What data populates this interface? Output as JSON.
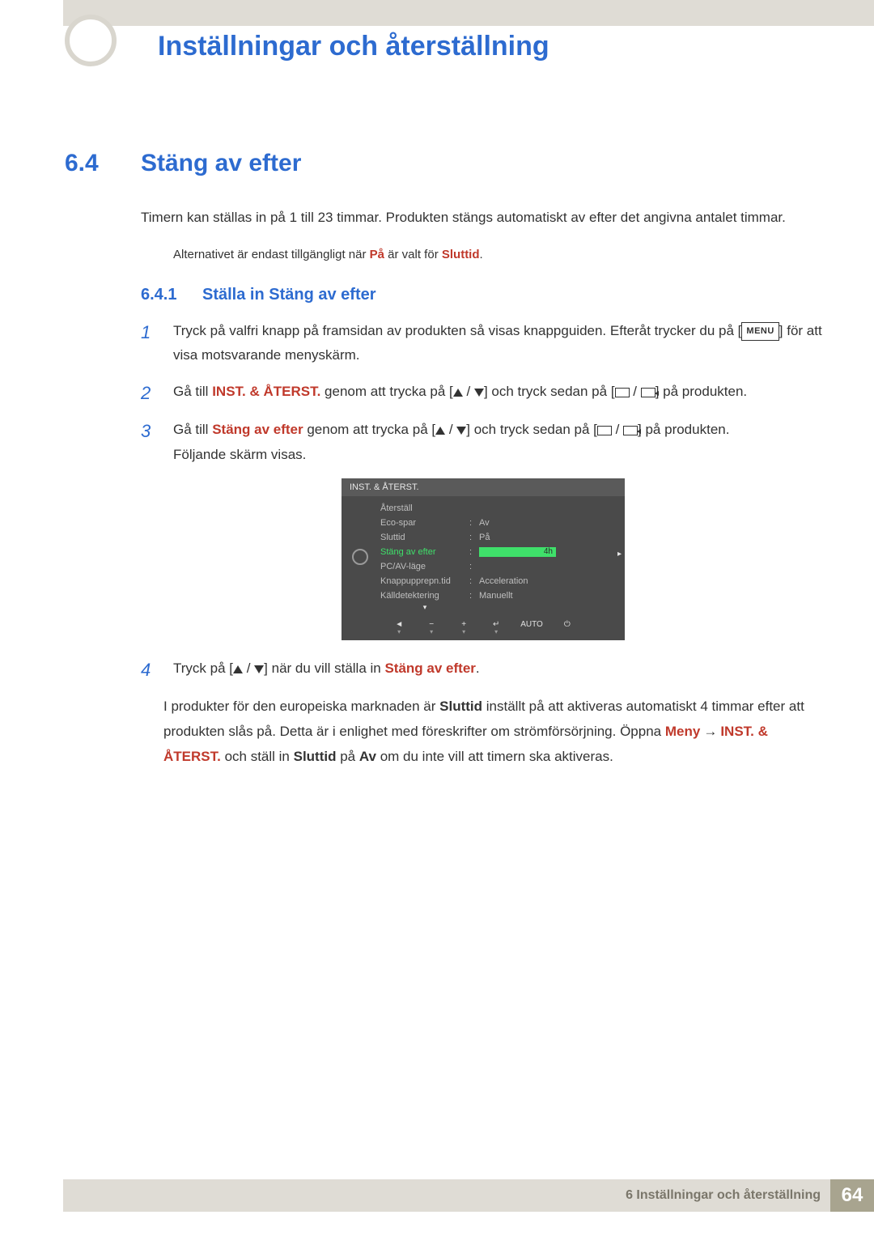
{
  "chapter_title": "Inställningar och återställning",
  "section": {
    "num": "6.4",
    "title": "Stäng av efter",
    "intro": "Timern kan ställas in på 1 till 23 timmar. Produkten stängs automatiskt av efter det angivna antalet timmar.",
    "note_pre": "Alternativet är endast tillgängligt när ",
    "note_bold1": "På",
    "note_mid": " är valt för ",
    "note_bold2": "Sluttid",
    "note_post": "."
  },
  "subsection": {
    "num": "6.4.1",
    "title": "Ställa in Stäng av efter"
  },
  "steps": {
    "s1": {
      "num": "1",
      "pre": "Tryck på valfri knapp på framsidan av produkten så visas knappguiden. Efteråt trycker du på [",
      "menu": "MENU",
      "post": "] för att visa motsvarande menyskärm."
    },
    "s2": {
      "num": "2",
      "pre": "Gå till ",
      "bold": "INST. & ÅTERST.",
      "mid": " genom att trycka på [",
      "mid2": "] och tryck sedan på [",
      "post": "] på produkten."
    },
    "s3": {
      "num": "3",
      "pre": "Gå till ",
      "bold": "Stäng av efter",
      "mid": " genom att trycka på [",
      "mid2": "] och tryck sedan på [",
      "post": "] på produkten.",
      "tail": "Följande skärm visas."
    },
    "s4": {
      "num": "4",
      "pre": "Tryck på [",
      "mid": "] när du vill ställa in ",
      "bold": "Stäng av efter",
      "post": "."
    }
  },
  "osd": {
    "header": "INST. & ÅTERST.",
    "rows": [
      {
        "label": "Återställ",
        "value": ""
      },
      {
        "label": "Eco-spar",
        "value": "Av"
      },
      {
        "label": "Sluttid",
        "value": "På"
      },
      {
        "label": "Stäng av efter",
        "value": "4h"
      },
      {
        "label": "PC/AV-läge",
        "value": ""
      },
      {
        "label": "Knappupprepn.tid",
        "value": "Acceleration"
      },
      {
        "label": "Källdetektering",
        "value": "Manuellt"
      }
    ],
    "footer_auto": "AUTO"
  },
  "info": {
    "pre": "I produkter för den europeiska marknaden är ",
    "b1": "Sluttid",
    "mid1": " inställt på att aktiveras automatiskt 4 timmar efter att produkten slås på. Detta är i enlighet med föreskrifter om strömförsörjning. Öppna ",
    "b2": "Meny",
    "b3": "INST. & ÅTERST.",
    "mid2": " och ställ in ",
    "b4": "Sluttid",
    "mid3": " på ",
    "b5": "Av",
    "post": " om du inte vill att timern ska aktiveras."
  },
  "footer": {
    "text": "6 Inställningar och återställning",
    "page": "64"
  }
}
